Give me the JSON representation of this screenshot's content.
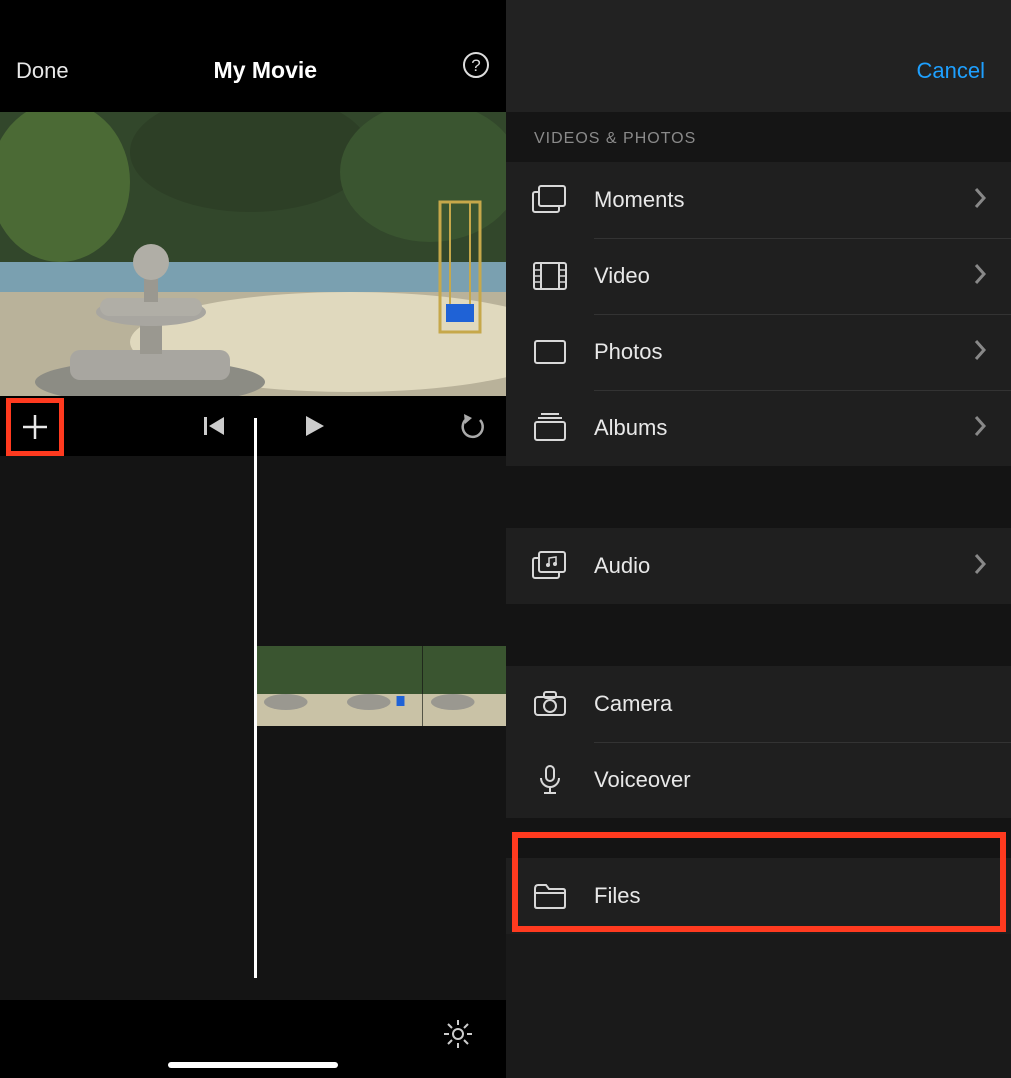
{
  "editor": {
    "done_label": "Done",
    "title": "My Movie",
    "help_icon": "question-circle",
    "add_icon": "plus",
    "skip_back_icon": "skip-back",
    "play_icon": "play",
    "undo_icon": "undo",
    "settings_icon": "gear"
  },
  "picker": {
    "cancel_label": "Cancel",
    "section_header": "VIDEOS & PHOTOS",
    "rows": {
      "moments": {
        "label": "Moments",
        "icon": "moments-icon",
        "disclosure": true
      },
      "video": {
        "label": "Video",
        "icon": "filmstrip-icon",
        "disclosure": true
      },
      "photos": {
        "label": "Photos",
        "icon": "photo-icon",
        "disclosure": true
      },
      "albums": {
        "label": "Albums",
        "icon": "albums-icon",
        "disclosure": true
      },
      "audio": {
        "label": "Audio",
        "icon": "audio-icon",
        "disclosure": true
      },
      "camera": {
        "label": "Camera",
        "icon": "camera-icon",
        "disclosure": false
      },
      "voiceover": {
        "label": "Voiceover",
        "icon": "microphone-icon",
        "disclosure": false
      },
      "files": {
        "label": "Files",
        "icon": "folder-icon",
        "disclosure": false
      }
    }
  },
  "annotations": {
    "highlight_color": "#ff3a1f",
    "add_button_highlighted": true,
    "files_row_highlighted": true
  }
}
